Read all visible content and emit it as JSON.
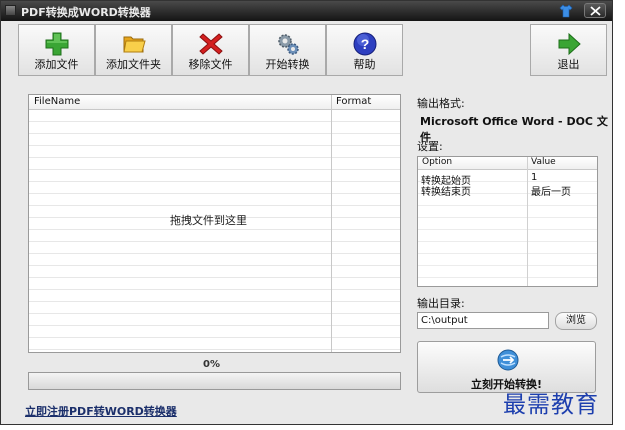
{
  "window": {
    "title": "PDF转换成WORD转换器"
  },
  "toolbar": {
    "add_file": "添加文件",
    "add_folder": "添加文件夹",
    "remove_file": "移除文件",
    "start_convert": "开始转换",
    "help": "帮助",
    "exit": "退出"
  },
  "file_list": {
    "columns": [
      "FileName",
      "Format"
    ],
    "drop_hint": "拖拽文件到这里"
  },
  "progress": {
    "label": "0%",
    "value": 0
  },
  "register_link": "立即注册PDF转WORD转换器",
  "output_format": {
    "label": "输出格式:",
    "value": "Microsoft Office Word - DOC 文件"
  },
  "settings": {
    "label": "设置:",
    "columns": [
      "Option",
      "Value"
    ],
    "rows": [
      {
        "option": "转换起始页",
        "value": "1"
      },
      {
        "option": "转换结束页",
        "value": "最后一页"
      }
    ]
  },
  "output_dir": {
    "label": "输出目录:",
    "value": "C:\\output",
    "browse": "浏览"
  },
  "start_button": "立刻开始转换!",
  "watermark": "最需教育",
  "colors": {
    "titlebar": "#1f1f1f",
    "add_green": "#3aa534",
    "remove_red": "#d42020",
    "help_blue": "#2d3fc0",
    "watermark": "#1d3fae"
  }
}
